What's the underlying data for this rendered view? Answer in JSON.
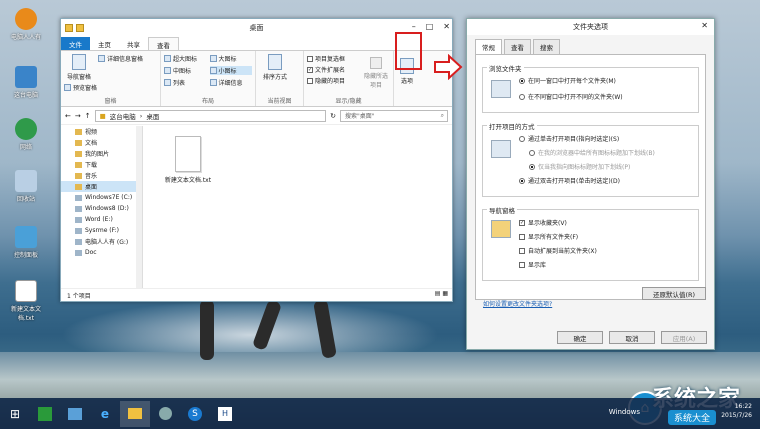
{
  "desktop": {
    "icons": [
      "电脑人人有",
      "这台电脑",
      "网络",
      "回收站",
      "控制面板",
      "新建文本文档.txt"
    ]
  },
  "explorer": {
    "title": "桌面",
    "tabs": [
      "文件",
      "主页",
      "共享",
      "查看"
    ],
    "ribbon": {
      "pane": {
        "nav": "导航窗格",
        "preview": "预览窗格",
        "details": "详细信息窗格",
        "label": "窗格"
      },
      "layout": {
        "items": [
          "超大图标",
          "大图标",
          "中图标",
          "小图标",
          "列表",
          "详细信息"
        ],
        "label": "布局"
      },
      "view": {
        "sort": "排序方式",
        "label": "当前视图"
      },
      "show": {
        "item_checkbox": "项目复选框",
        "file_ext": "文件扩展名",
        "hidden": "隐藏的项目",
        "hide_sel": "隐藏所选项目",
        "label": "显示/隐藏"
      },
      "options": "选项"
    },
    "address": {
      "path": [
        "这台电脑",
        "桌面"
      ],
      "search_placeholder": "搜索\"桌面\""
    },
    "nav_items": [
      "视频",
      "文档",
      "我的图片",
      "下载",
      "音乐",
      "桌面",
      "Windows7E (C:)",
      "Windows8 (D:)",
      "Word (E:)",
      "Sysrme (F:)",
      "电脑人人有 (G:)",
      "Doc"
    ],
    "file": {
      "name": "新建文本文档.txt"
    },
    "status": "1 个项目"
  },
  "dialog": {
    "title": "文件夹选项",
    "tabs": [
      "常规",
      "查看",
      "搜索"
    ],
    "browse": {
      "legend": "浏览文件夹",
      "opt1": "在同一窗口中打开每个文件夹(M)",
      "opt2": "在不同窗口中打开不同的文件夹(W)"
    },
    "click": {
      "legend": "打开项目的方式",
      "opt1": "通过单击打开项目(指向时选定)(S)",
      "sub1": "在我的浏览器中给所有图标标题加下划线(B)",
      "sub2": "仅当我指向图标标题时加下划线(P)",
      "opt2": "通过双击打开项目(单击时选定)(D)"
    },
    "nav": {
      "legend": "导航窗格",
      "c1": "显示收藏夹(V)",
      "c2": "显示所有文件夹(F)",
      "c3": "自动扩展到当前文件夹(X)",
      "c4": "显示库"
    },
    "restore": "还原默认值(R)",
    "link": "如何设置更改文件夹选项?",
    "ok": "确定",
    "cancel": "取消",
    "apply": "应用(A)"
  },
  "taskbar": {
    "tray_text": "Windows",
    "time": "16:22",
    "date": "2015/7/26"
  },
  "watermark": {
    "name": "系统之家",
    "sub": "系统大全"
  }
}
